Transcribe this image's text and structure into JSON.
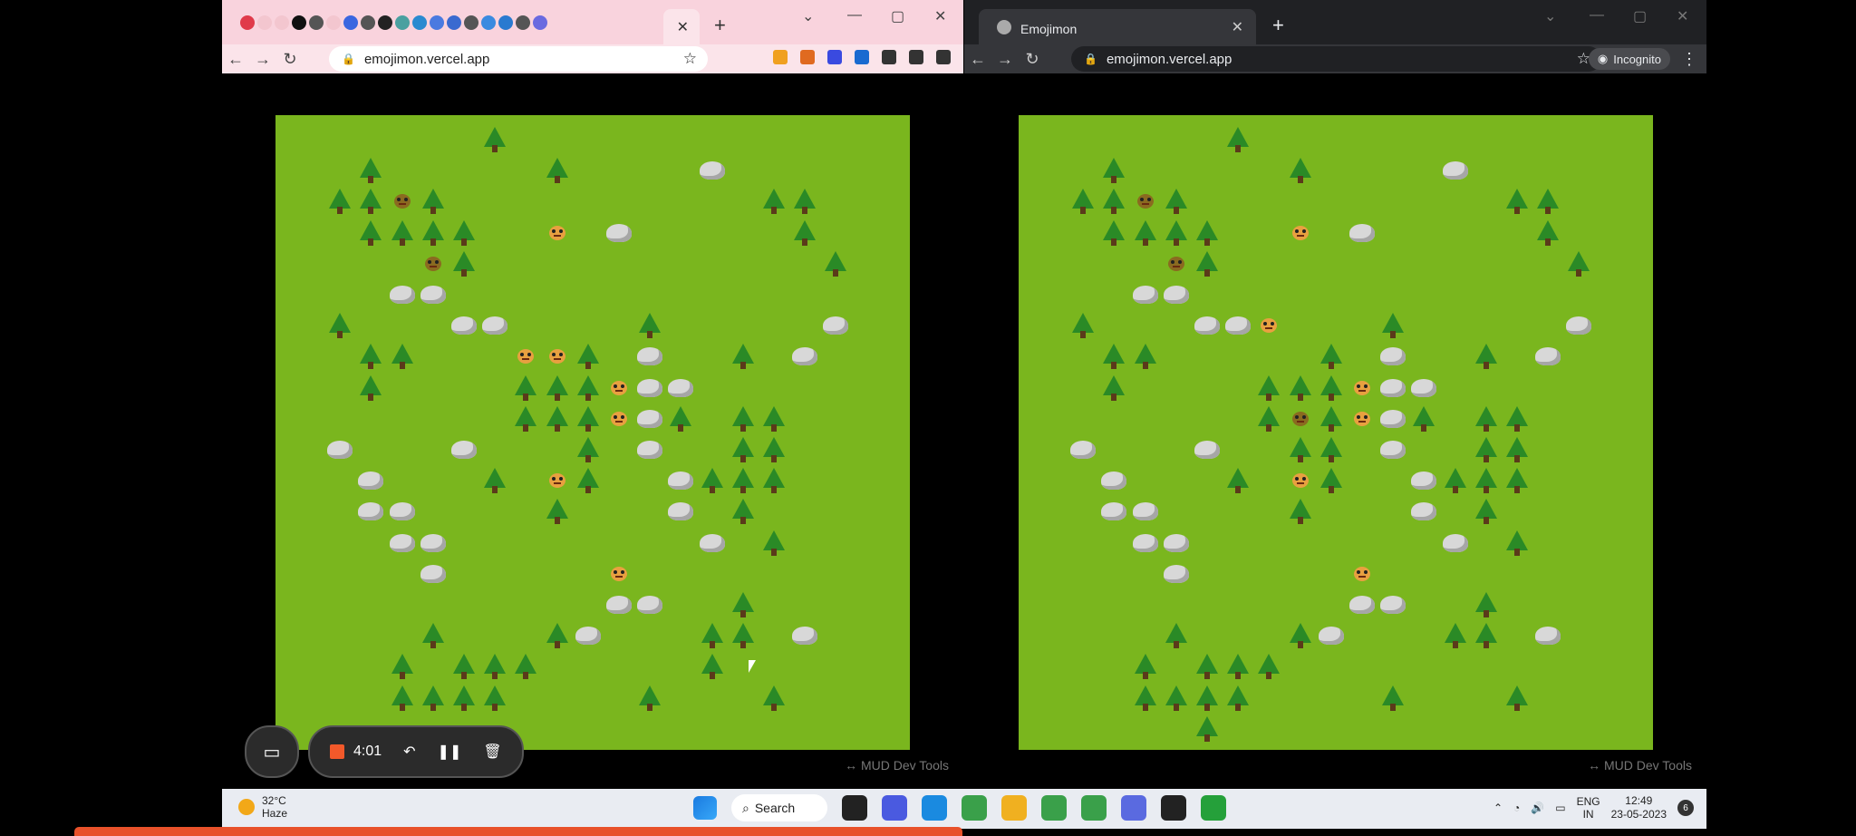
{
  "left_window": {
    "url": "emojimon.vercel.app",
    "watermark": "↔ MUD Dev Tools",
    "tab_icon_colors": [
      "#e03a4a",
      "#f3c6cf",
      "#f3c6cf",
      "#111111",
      "#555555",
      "#f3c6cf",
      "#3a66e0",
      "#555555",
      "#222222",
      "#4aa0a0",
      "#2a8ad0",
      "#4a7ae0",
      "#3a6ad0",
      "#555555",
      "#3a8ae0",
      "#2a7ad0",
      "#555555",
      "#6a6ae0"
    ],
    "ext_icon_colors": [
      "#f0a020",
      "#e06a20",
      "#3a4ae0",
      "#1a6ad0",
      "#333333",
      "#333333",
      "#333333"
    ]
  },
  "right_window": {
    "tab_title": "Emojimon",
    "url": "emojimon.vercel.app",
    "incognito_label": "Incognito",
    "watermark": "↔ MUD Dev Tools"
  },
  "recorder": {
    "timer": "4:01"
  },
  "taskbar": {
    "temperature": "32°C",
    "weather": "Haze",
    "search_label": "Search",
    "lang_top": "ENG",
    "lang_bottom": "IN",
    "time": "12:49",
    "date": "23-05-2023",
    "notification_count": "6",
    "app_colors": [
      "#222222",
      "#4a5ae0",
      "#1a8ae0",
      "#3aa04a",
      "#f0b020",
      "#3aa04a",
      "#3aa04a",
      "#5a6ae0",
      "#222222",
      "#25a03a"
    ]
  },
  "colors": {
    "grass": "#7ab61e",
    "tree": "#2a8a26",
    "rock": "#d8d8d8",
    "recorder_stop": "#f2592a"
  }
}
